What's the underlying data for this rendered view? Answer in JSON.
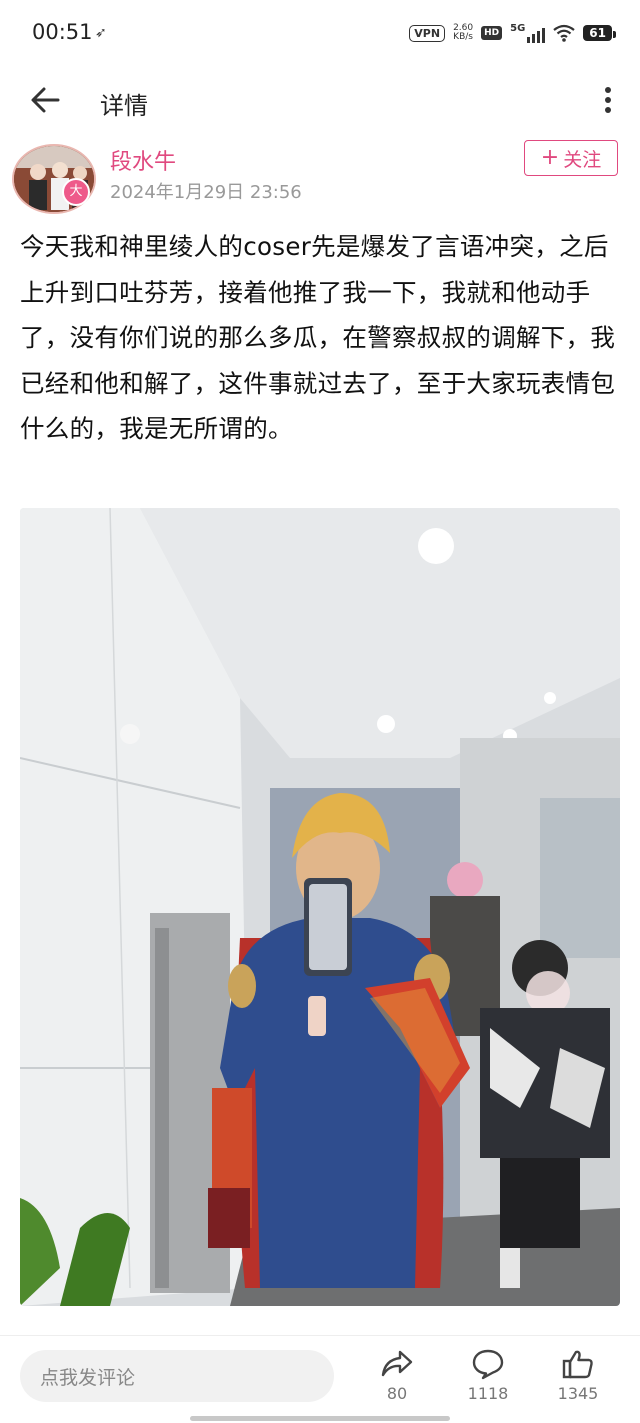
{
  "status": {
    "time": "00:51",
    "vpn_label": "VPN",
    "net_speed_value": "2.60",
    "net_speed_unit": "KB/s",
    "hd_label": "HD",
    "signal_label": "5G",
    "battery": "61"
  },
  "app_bar": {
    "title": "详情"
  },
  "author": {
    "name": "段水牛",
    "timestamp": "2024年1月29日 23:56",
    "badge": "大",
    "follow_label": "关注"
  },
  "post": {
    "text": "今天我和神里绫人的coser先是爆发了言语冲突，之后上升到口吐芬芳，接着他推了我一下，我就和他动手了，没有你们说的那么多瓜，在警察叔叔的调解下，我已经和他和解了，这件事就过去了，至于大家玩表情包什么的，我是无所谓的。"
  },
  "bottom_bar": {
    "comment_placeholder": "点我发评论",
    "share_count": "80",
    "comment_count": "1118",
    "like_count": "1345"
  },
  "colors": {
    "accent": "#e0497f"
  }
}
